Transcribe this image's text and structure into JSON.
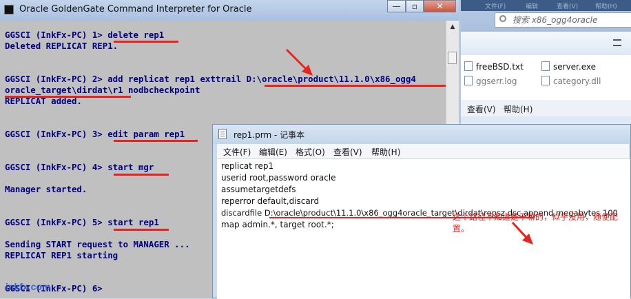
{
  "explorer": {
    "tab_labels": [
      "文件(F)",
      "编辑",
      "查看(V)",
      "帮助(H)"
    ],
    "search_placeholder": "搜索 x86_ogg4oracle",
    "files": [
      "freeBSD.txt",
      "server.exe",
      "ggserr.log",
      "category.dll"
    ],
    "menu": [
      "查看(V)",
      "帮助(H)"
    ]
  },
  "console": {
    "title": "Oracle GoldenGate Command Interpreter for Oracle",
    "window_buttons": [
      "—",
      "▫",
      "✕"
    ],
    "lines": [
      "GGSCI (InkFx-PC) 1> delete rep1",
      "Deleted REPLICAT REP1.",
      "GGSCI (InkFx-PC) 2> add replicat rep1 exttrail D:\\oracle\\product\\11.1.0\\x86_ogg4",
      "oracle_target\\dirdat\\r1 nodbcheckpoint",
      "REPLICAT added.",
      "GGSCI (InkFx-PC) 3> edit param rep1",
      "GGSCI (InkFx-PC) 4> start mgr",
      "Manager started.",
      "GGSCI (InkFx-PC) 5> start rep1",
      "Sending START request to MANAGER ...",
      "REPLICAT REP1 starting",
      "GGSCI (InkFx-PC) 6>"
    ]
  },
  "notepad": {
    "title": "rep1.prm - 记事本",
    "menu": [
      "文件(F)",
      "编辑(E)",
      "格式(O)",
      "查看(V)",
      "帮助(H)"
    ],
    "lines": [
      "replicat rep1",
      "userid root,password oracle",
      "assumetargetdefs",
      "reperror default,discard",
      "discardfile D:\\oracle\\product\\11.1.0\\x86_ogg4oracle_target\\dirdat\\repsz.dsc,append,megabytes 100",
      "map admin.*, target root.*;"
    ],
    "annotation": "这个路径不知道是干嘛的，似乎没用，随便配置。"
  },
  "watermark": "inkfx.com",
  "colors": {
    "console_bg": "#c0c0c0",
    "console_text": "#000080",
    "highlight_red": "#e8231f"
  }
}
